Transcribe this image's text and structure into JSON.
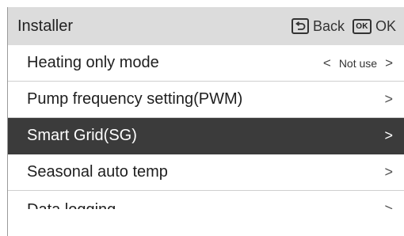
{
  "header": {
    "title": "Installer",
    "back_label": "Back",
    "ok_icon_text": "OK",
    "ok_label": "OK"
  },
  "menu": {
    "items": [
      {
        "label": "Heating only mode",
        "value": "Not use",
        "left_arrow": "<",
        "right_arrow": ">"
      },
      {
        "label": "Pump frequency setting(PWM)",
        "chevron": ">"
      },
      {
        "label": "Smart Grid(SG)",
        "chevron": ">"
      },
      {
        "label": "Seasonal auto temp",
        "chevron": ">"
      },
      {
        "label": "Data logging",
        "chevron": ">"
      }
    ],
    "selected_index": 2
  },
  "colors": {
    "header_bg": "#dcdcdc",
    "selected_bg": "#3b3b3b",
    "text": "#1e1e1e"
  }
}
